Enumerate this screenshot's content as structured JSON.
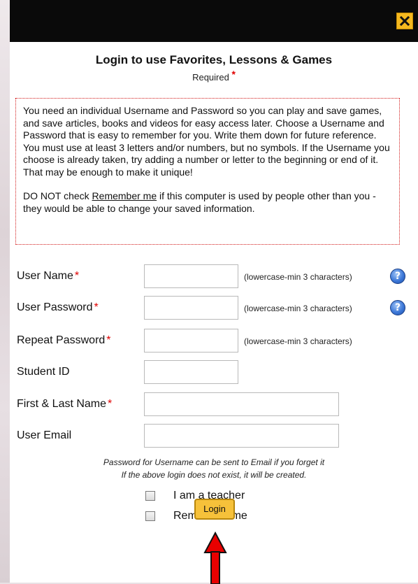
{
  "dialog": {
    "close_icon": "close-x-icon",
    "title": "Login to use Favorites, Lessons & Games",
    "required_label": "Required",
    "required_star": "*",
    "info_paragraph_1": "You need an individual Username and Password so you can play and save games, and save articles, books and videos for easy access later. Choose a Username and Password that is easy to remember for you. Write them down for future reference. You must use at least 3 letters and/or numbers, but no symbols. If the Username you choose is already taken, try adding a number or letter to the beginning or end of it. That may be enough to make it unique!",
    "info_paragraph_2_before": "DO NOT check ",
    "info_paragraph_2_link": "Remember me",
    "info_paragraph_2_after": " if this computer is used by people other than you - they would be able to change your saved information."
  },
  "form": {
    "fields": [
      {
        "label": "User Name",
        "required": "*",
        "value": "",
        "hint": "(lowercase-min 3 characters)",
        "help_icon": "help-question-icon"
      },
      {
        "label": "User Password",
        "required": "*",
        "value": "",
        "hint": "(lowercase-min 3 characters)",
        "help_icon": "help-question-icon"
      },
      {
        "label": "Repeat Password",
        "required": "*",
        "value": "",
        "hint": "(lowercase-min 3 characters)"
      },
      {
        "label": "Student ID",
        "value": ""
      },
      {
        "label": "First & Last Name",
        "required": "*",
        "value": ""
      },
      {
        "label": "User Email",
        "value": ""
      }
    ],
    "note_1": "Password for Username can be sent to Email if you forget it",
    "note_2": "If the above login does not exist, it will be created.",
    "checkbox_teacher": "I am a teacher",
    "checkbox_remember": "Remember me",
    "login_button": "Login"
  },
  "colors": {
    "accent_button": "#f6c13a",
    "required_star": "#e00000",
    "info_border": "#d21a1a"
  }
}
